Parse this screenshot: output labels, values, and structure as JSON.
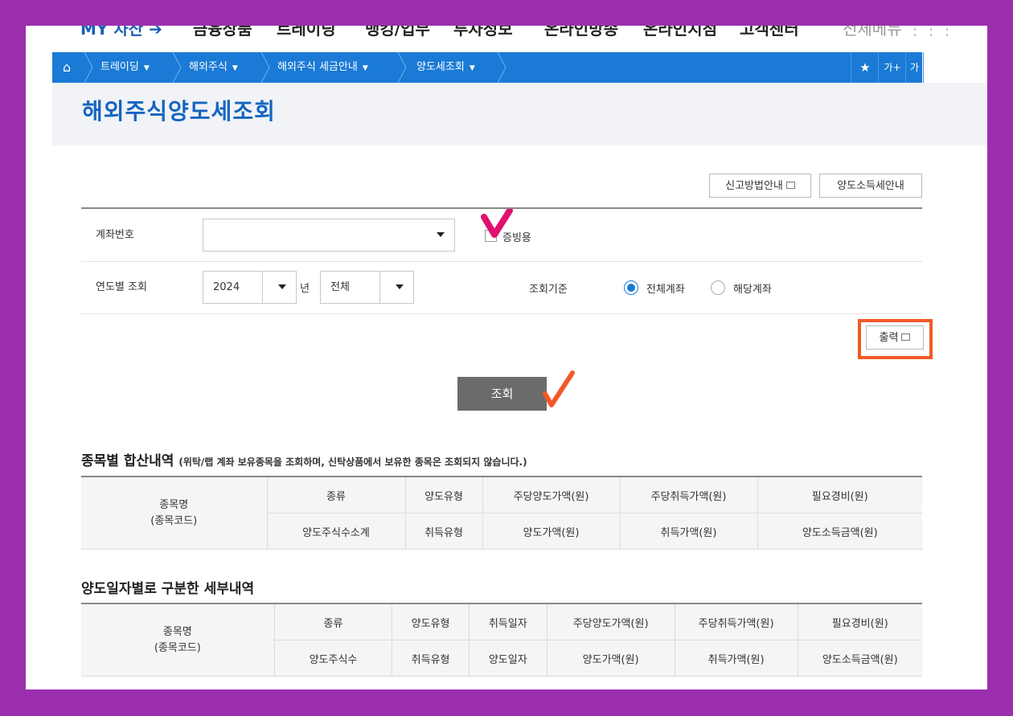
{
  "topnav": {
    "my_asset": "MY 자산",
    "items": [
      "금융상품",
      "트레이딩",
      "뱅킹/업무",
      "투자정보",
      "온라인방송",
      "온라인지점",
      "고객센터"
    ],
    "all_menu": "전체메뉴"
  },
  "breadcrumb": {
    "items": [
      "트레이딩",
      "해외주식",
      "해외주식 세금안내",
      "양도세조회"
    ],
    "font_plus": "가+",
    "font_minus": "가−"
  },
  "page_title": "해외주식양도세조회",
  "guide_buttons": {
    "filing_guide": "신고방법안내",
    "tax_guide": "양도소득세안내"
  },
  "form": {
    "account_label": "계좌번호",
    "account_value": "",
    "proof_label": "증빙용",
    "year_label": "연도별 조회",
    "year_value": "2024",
    "year_unit": "년",
    "period_value": "전체",
    "basis_label": "조회기준",
    "basis_options": [
      "전체계좌",
      "해당계좌"
    ],
    "basis_selected": "전체계좌"
  },
  "print_button": "출력",
  "search_button": "조회",
  "summary_section": {
    "title": "종목별 합산내역",
    "note": "(위탁/랩 계좌 보유종목을 조회하며, 신탁상품에서 보유한 종목은 조회되지 않습니다.)",
    "name_header": [
      "종목명",
      "(종목코드)"
    ],
    "row1": [
      "종류",
      "양도유형",
      "주당양도가액(원)",
      "주당취득가액(원)",
      "필요경비(원)"
    ],
    "row2": [
      "양도주식수소계",
      "취득유형",
      "양도가액(원)",
      "취득가액(원)",
      "양도소득금액(원)"
    ]
  },
  "detail_section": {
    "title": "양도일자별로 구분한 세부내역",
    "name_header": [
      "종목명",
      "(종목코드)"
    ],
    "row1": [
      "종류",
      "양도유형",
      "취득일자",
      "주당양도가액(원)",
      "주당취득가액(원)",
      "필요경비(원)"
    ],
    "row2": [
      "양도주식수",
      "취득유형",
      "양도일자",
      "양도가액(원)",
      "취득가액(원)",
      "양도소득금액(원)"
    ]
  },
  "colors": {
    "frame_background": "#9b2fae",
    "breadcrumb_bar": "#1a7ad6",
    "title_text": "#1565c0",
    "highlight_box": "#f05a28",
    "check_pink": "#e0106e",
    "check_orange": "#f05a28",
    "search_button": "#6b6b6b"
  }
}
